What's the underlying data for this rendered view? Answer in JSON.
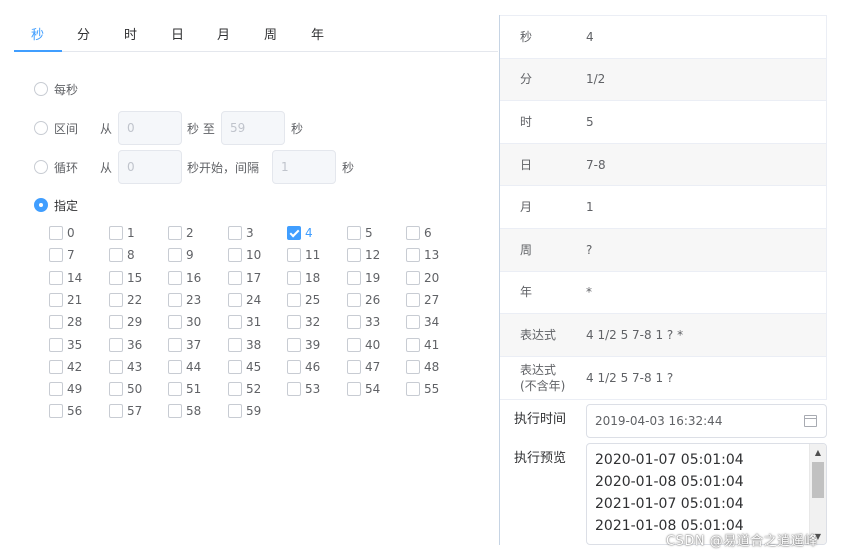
{
  "tabs": [
    "秒",
    "分",
    "时",
    "日",
    "月",
    "周",
    "年"
  ],
  "active_tab": "秒",
  "options": {
    "every": "每秒",
    "range": {
      "label": "区间",
      "from": "从",
      "from_value": "0",
      "mid": "秒 至",
      "to_value": "59",
      "unit": "秒"
    },
    "loop": {
      "label": "循环",
      "from": "从",
      "from_value": "0",
      "mid": "秒开始，间隔",
      "step_value": "1",
      "unit": "秒"
    },
    "specify": "指定"
  },
  "selected_option": "specify",
  "seconds": [
    "0",
    "1",
    "2",
    "3",
    "4",
    "5",
    "6",
    "7",
    "8",
    "9",
    "10",
    "11",
    "12",
    "13",
    "14",
    "15",
    "16",
    "17",
    "18",
    "19",
    "20",
    "21",
    "22",
    "23",
    "24",
    "25",
    "26",
    "27",
    "28",
    "29",
    "30",
    "31",
    "32",
    "33",
    "34",
    "35",
    "36",
    "37",
    "38",
    "39",
    "40",
    "41",
    "42",
    "43",
    "44",
    "45",
    "46",
    "47",
    "48",
    "49",
    "50",
    "51",
    "52",
    "53",
    "54",
    "55",
    "56",
    "57",
    "58",
    "59"
  ],
  "checked_seconds": [
    "4"
  ],
  "summary": [
    {
      "label": "秒",
      "value": "4"
    },
    {
      "label": "分",
      "value": "1/2"
    },
    {
      "label": "时",
      "value": "5"
    },
    {
      "label": "日",
      "value": "7-8"
    },
    {
      "label": "月",
      "value": "1"
    },
    {
      "label": "周",
      "value": "?"
    },
    {
      "label": "年",
      "value": "*"
    },
    {
      "label": "表达式",
      "value": "4 1/2 5 7-8 1 ? *"
    },
    {
      "label": "表达式\n(不含年)",
      "value": "4 1/2 5 7-8 1 ?"
    }
  ],
  "exec_time": {
    "label": "执行时间",
    "value": "2019-04-03 16:32:44"
  },
  "exec_preview": {
    "label": "执行预览",
    "lines": [
      "2020-01-07 05:01:04",
      "2020-01-08 05:01:04",
      "2021-01-07 05:01:04",
      "2021-01-08 05:01:04"
    ]
  },
  "watermark": "CSDN @易道合之逍遥峰",
  "colors": {
    "accent": "#409eff",
    "border": "#dcdfe6",
    "row_alt": "#f7f7f7",
    "divider": "#c6d4e4"
  }
}
